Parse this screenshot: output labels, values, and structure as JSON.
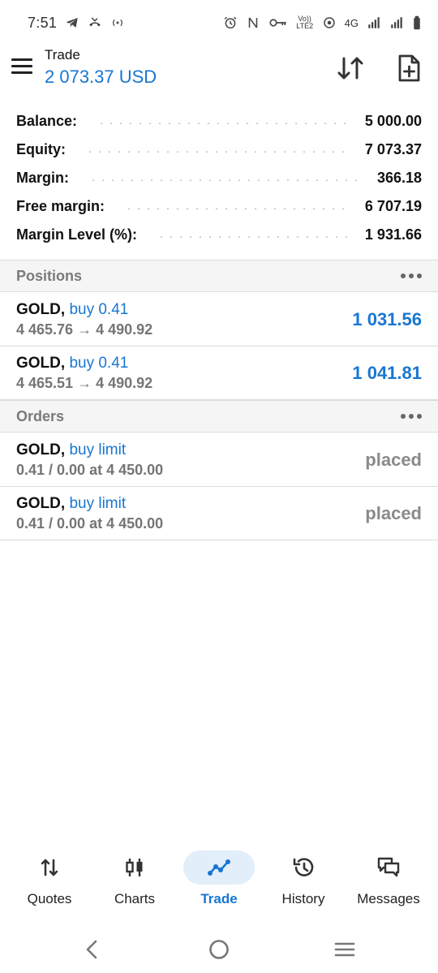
{
  "status_bar": {
    "time": "7:51",
    "network": "4G",
    "volte": "Vo)) LTE2"
  },
  "header": {
    "title": "Trade",
    "balance": "2 073.37 USD"
  },
  "summary": [
    {
      "label": "Balance:",
      "value": "5 000.00"
    },
    {
      "label": "Equity:",
      "value": "7 073.37"
    },
    {
      "label": "Margin:",
      "value": "366.18"
    },
    {
      "label": "Free margin:",
      "value": "6 707.19"
    },
    {
      "label": "Margin Level (%):",
      "value": "1 931.66"
    }
  ],
  "positions": {
    "title": "Positions",
    "items": [
      {
        "symbol": "GOLD,",
        "side": "buy 0.41",
        "prices": "4 465.76 → 4 490.92",
        "profit": "1 031.56"
      },
      {
        "symbol": "GOLD,",
        "side": "buy 0.41",
        "prices": "4 465.51 → 4 490.92",
        "profit": "1 041.81"
      }
    ]
  },
  "orders": {
    "title": "Orders",
    "items": [
      {
        "symbol": "GOLD,",
        "side": "buy limit",
        "details": "0.41 / 0.00 at 4 450.00",
        "status": "placed"
      },
      {
        "symbol": "GOLD,",
        "side": "buy limit",
        "details": "0.41 / 0.00 at 4 450.00",
        "status": "placed"
      }
    ]
  },
  "bottom_nav": {
    "active": "Trade",
    "items": [
      {
        "label": "Quotes",
        "icon": "quotes-icon"
      },
      {
        "label": "Charts",
        "icon": "candlestick-icon"
      },
      {
        "label": "Trade",
        "icon": "trade-line-icon"
      },
      {
        "label": "History",
        "icon": "history-icon"
      },
      {
        "label": "Messages",
        "icon": "messages-icon"
      }
    ]
  },
  "colors": {
    "accent": "#1976d2",
    "muted": "#757575",
    "section_bg": "#f5f5f5",
    "nav_active_bg": "#e3eefb"
  }
}
